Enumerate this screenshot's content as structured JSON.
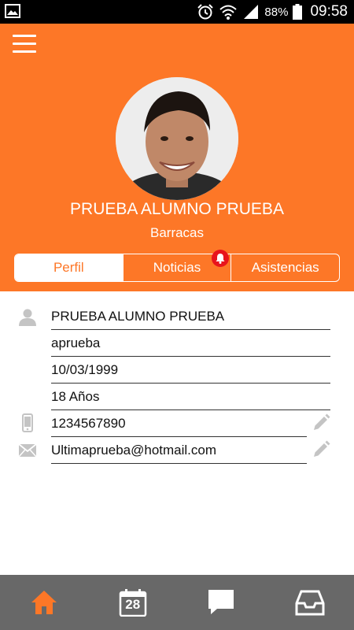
{
  "status_bar": {
    "battery_percent": "88%",
    "time": "09:58",
    "icons": [
      "gallery-icon",
      "alarm-icon",
      "wifi-icon",
      "signal-icon",
      "battery-icon"
    ]
  },
  "header": {
    "menu_icon": "hamburger-menu-icon",
    "student_name": "PRUEBA ALUMNO PRUEBA",
    "location": "Barracas",
    "accent_color": "#fd7727"
  },
  "tabs": [
    {
      "label": "Perfil",
      "active": true
    },
    {
      "label": "Noticias",
      "active": false,
      "badge_icon": "bell-icon"
    },
    {
      "label": "Asistencias",
      "active": false
    }
  ],
  "profile": {
    "full_name": "PRUEBA ALUMNO PRUEBA",
    "username": "aprueba",
    "birth_date": "10/03/1999",
    "age": "18 Años",
    "phone": "1234567890",
    "email": "Ultimaprueba@hotmail.com",
    "icons": [
      "person-icon",
      "phone-icon",
      "mail-icon",
      "pencil-icon"
    ]
  },
  "bottom_nav": {
    "items": [
      "home-icon",
      "calendar-icon",
      "chat-icon",
      "inbox-icon"
    ],
    "calendar_day": "28",
    "active_item": "home-icon"
  }
}
